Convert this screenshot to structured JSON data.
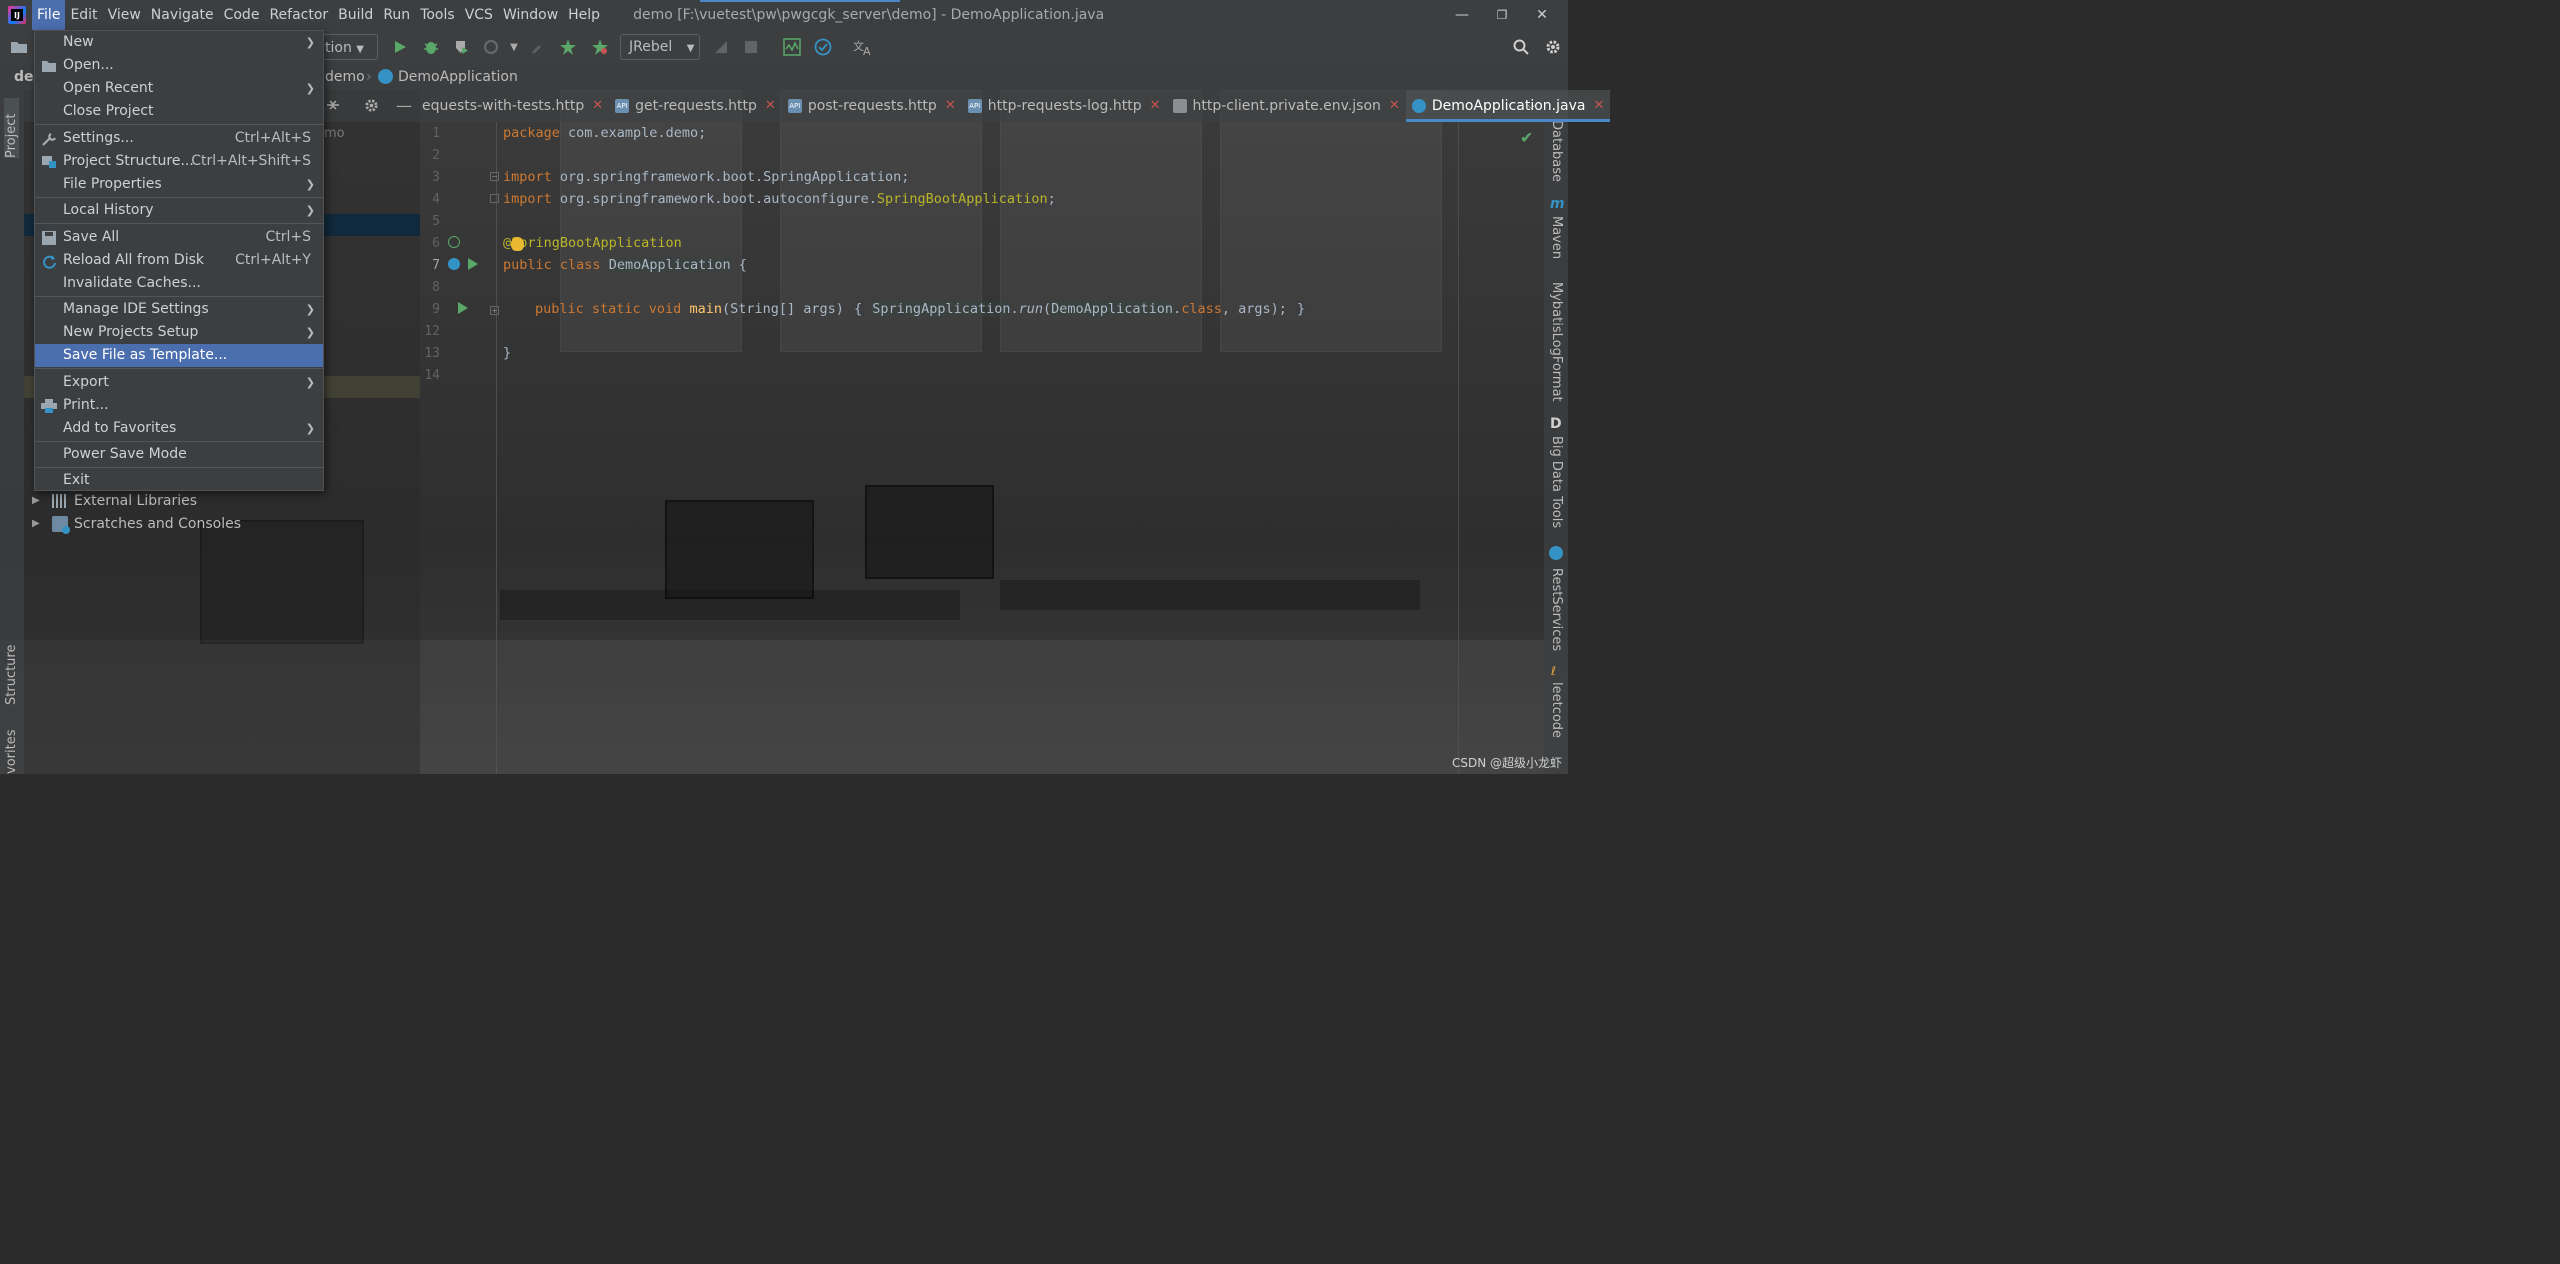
{
  "window": {
    "title": "demo [F:\\vuetest\\pw\\pwgcgk_server\\demo] - DemoApplication.java",
    "minimize_glyph": "—",
    "restore_glyph": "❐",
    "close_glyph": "✕"
  },
  "menubar": {
    "items": [
      "File",
      "Edit",
      "View",
      "Navigate",
      "Code",
      "Refactor",
      "Build",
      "Run",
      "Tools",
      "VCS",
      "Window",
      "Help"
    ],
    "active": "File"
  },
  "toolbar": {
    "run_config_label": "tion",
    "jrebel_label": "JRebel"
  },
  "breadcrumb": {
    "project": "dem",
    "module": "demo",
    "file": "DemoApplication"
  },
  "left_stripe": {
    "project": "Project",
    "structure": "Structure",
    "favorites": "vorites"
  },
  "right_stripe": {
    "items": [
      "Database",
      "Maven",
      "MybatisLogFormat",
      "Big Data Tools",
      "RestServices",
      "leetcode"
    ]
  },
  "project_panel": {
    "partial_text": "mo",
    "tree": [
      {
        "label": "External Libraries"
      },
      {
        "label": "Scratches and Consoles"
      }
    ]
  },
  "file_menu": {
    "items": [
      {
        "label": "New",
        "shortcut": "",
        "submenu": true
      },
      {
        "label": "Open...",
        "shortcut": "",
        "submenu": false
      },
      {
        "label": "Open Recent",
        "shortcut": "",
        "submenu": true
      },
      {
        "label": "Close Project",
        "shortcut": "",
        "submenu": false
      },
      {
        "label": "Settings...",
        "shortcut": "Ctrl+Alt+S",
        "submenu": false
      },
      {
        "label": "Project Structure...",
        "shortcut": "Ctrl+Alt+Shift+S",
        "submenu": false
      },
      {
        "label": "File Properties",
        "shortcut": "",
        "submenu": true
      },
      {
        "label": "Local History",
        "shortcut": "",
        "submenu": true
      },
      {
        "label": "Save All",
        "shortcut": "Ctrl+S",
        "submenu": false
      },
      {
        "label": "Reload All from Disk",
        "shortcut": "Ctrl+Alt+Y",
        "submenu": false
      },
      {
        "label": "Invalidate Caches...",
        "shortcut": "",
        "submenu": false
      },
      {
        "label": "Manage IDE Settings",
        "shortcut": "",
        "submenu": true
      },
      {
        "label": "New Projects Setup",
        "shortcut": "",
        "submenu": true
      },
      {
        "label": "Save File as Template...",
        "shortcut": "",
        "submenu": false
      },
      {
        "label": "Export",
        "shortcut": "",
        "submenu": true
      },
      {
        "label": "Print...",
        "shortcut": "",
        "submenu": false
      },
      {
        "label": "Add to Favorites",
        "shortcut": "",
        "submenu": true
      },
      {
        "label": "Power Save Mode",
        "shortcut": "",
        "submenu": false
      },
      {
        "label": "Exit",
        "shortcut": "",
        "submenu": false
      }
    ],
    "highlighted": "Save File as Template..."
  },
  "editor": {
    "tabs": [
      {
        "label": "equests-with-tests.http",
        "active": false
      },
      {
        "label": "get-requests.http",
        "active": false
      },
      {
        "label": "post-requests.http",
        "active": false
      },
      {
        "label": "http-requests-log.http",
        "active": false
      },
      {
        "label": "http-client.private.env.json",
        "active": false
      },
      {
        "label": "DemoApplication.java",
        "active": true
      }
    ],
    "line_numbers": [
      "1",
      "2",
      "3",
      "4",
      "5",
      "6",
      "7",
      "8",
      "9",
      "12",
      "13",
      "14"
    ],
    "code": {
      "l1_kw": "package",
      "l1_rest": " com.example.demo;",
      "l3_kw": "import",
      "l3_rest": " org.springframework.boot.SpringApplication;",
      "l4_kw": "import",
      "l4_rest": " org.springframework.boot.autoconfigure.",
      "l4_ann": "SpringBootApplication",
      "l4_end": ";",
      "l6_ann": "@SpringBootApplication",
      "l7_kw": "public class",
      "l7_cls": "DemoApplication",
      "l7_end": " {",
      "l9_kw": "public static void",
      "l9_fn": "main",
      "l9_args": "(String[] args) ",
      "l9_fold": "{",
      "l9_cls": "SpringApplication",
      "l9_dot": ".",
      "l9_run": "run",
      "l9_paren": "(",
      "l9_cls2": "DemoApplication",
      "l9_dotclass": ".",
      "l9_classkw": "class",
      "l9_tail": ", args);",
      "l9_close": "}",
      "l13": "}"
    }
  },
  "watermark": "CSDN @超级小龙虾"
}
